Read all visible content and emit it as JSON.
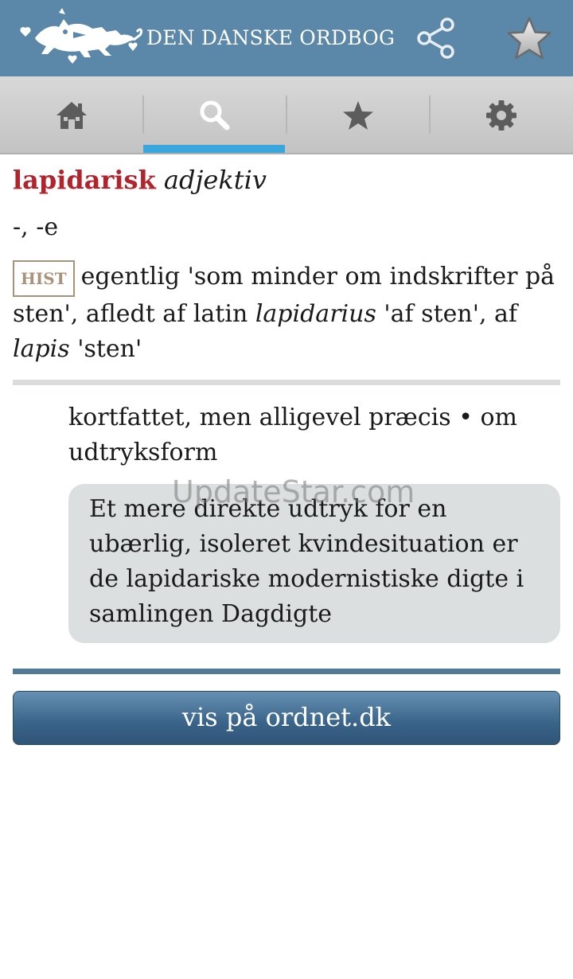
{
  "app": {
    "title": "DEN DANSKE ORDBOG",
    "brand_color": "#5b87a8",
    "icons": [
      "lions-logo",
      "share-icon",
      "favorite-star-icon"
    ]
  },
  "tabs": [
    {
      "name": "home",
      "icon": "home-icon",
      "active": false
    },
    {
      "name": "search",
      "icon": "search-icon",
      "active": true
    },
    {
      "name": "favorites",
      "icon": "star-icon",
      "active": false
    },
    {
      "name": "settings",
      "icon": "gear-icon",
      "active": false
    }
  ],
  "tab_indicator_color": "#3aa6de",
  "entry": {
    "headword": "lapidarisk",
    "part_of_speech": "adjektiv",
    "inflection": "-, -e",
    "etymology": {
      "badge": "HIST",
      "text_1": "egentlig 'som minder om indskrifter på sten', afledt af latin",
      "term_1": "lapidarius",
      "text_2": "'af sten', af",
      "term_2": "lapis",
      "text_3": "'sten'"
    },
    "definition": "kortfattet, men alligevel præcis • om udtryksform",
    "example": "Et mere direkte udtryk for en ubærlig, isoleret kvindesituation er de lapidariske modernistiske digte i samlingen Dagdigte"
  },
  "watermark": "UpdateStar.com",
  "button": {
    "label": "vis på ordnet.dk"
  },
  "colors": {
    "headword": "#b2232c",
    "badge": "#a8927a",
    "example_bg": "#dbdfe0",
    "button": "#3a6389"
  }
}
